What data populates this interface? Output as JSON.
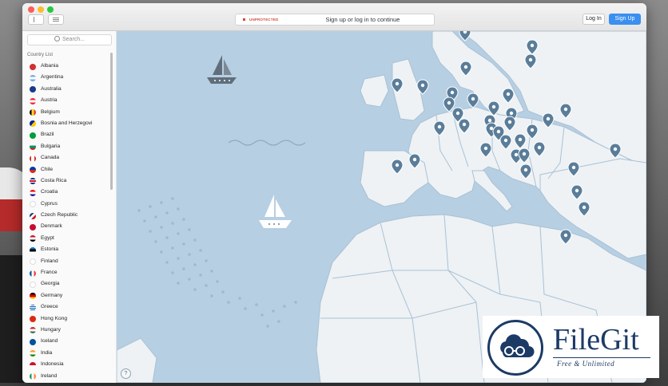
{
  "titlebar": {
    "status_label": "UNPROTECTED",
    "status_message": "Sign up or log in to continue",
    "login_label": "Log In",
    "signup_label": "Sign Up"
  },
  "sidebar": {
    "search_placeholder": "Search...",
    "list_header": "Country List",
    "countries": [
      {
        "name": "Albania"
      },
      {
        "name": "Argentina"
      },
      {
        "name": "Australia"
      },
      {
        "name": "Austria"
      },
      {
        "name": "Belgium"
      },
      {
        "name": "Bosnia and Herzegovi"
      },
      {
        "name": "Brazil"
      },
      {
        "name": "Bulgaria"
      },
      {
        "name": "Canada"
      },
      {
        "name": "Chile"
      },
      {
        "name": "Costa Rica"
      },
      {
        "name": "Croatia"
      },
      {
        "name": "Cyprus"
      },
      {
        "name": "Czech Republic"
      },
      {
        "name": "Denmark"
      },
      {
        "name": "Egypt"
      },
      {
        "name": "Estonia"
      },
      {
        "name": "Finland"
      },
      {
        "name": "France"
      },
      {
        "name": "Georgia"
      },
      {
        "name": "Germany"
      },
      {
        "name": "Greece"
      },
      {
        "name": "Hong Kong"
      },
      {
        "name": "Hungary"
      },
      {
        "name": "Iceland"
      },
      {
        "name": "India"
      },
      {
        "name": "Indonesia"
      },
      {
        "name": "Ireland"
      }
    ]
  },
  "map": {
    "help_label": "?"
  },
  "watermark": {
    "title": "FileGit",
    "subtitle": "Free & Unlimited"
  },
  "colors": {
    "accent": "#3a8ff0",
    "unprotected": "#d0493a",
    "sea": "#b7cfe2",
    "land": "#eef2f5",
    "border": "#a9c1d5",
    "pin": "#5a7d99"
  }
}
